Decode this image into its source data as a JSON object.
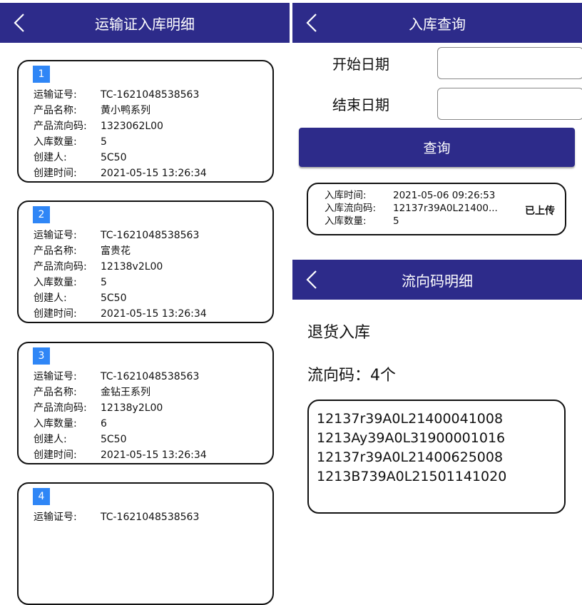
{
  "left_panel": {
    "title": "运输证入库明细",
    "cards": [
      {
        "index": "1",
        "rows": [
          [
            "运输证号:",
            "TC-1621048538563"
          ],
          [
            "产品名称:",
            "黄小鸭系列"
          ],
          [
            "产品流向码:",
            "1323062L00"
          ],
          [
            "入库数量:",
            "5"
          ],
          [
            "创建人:",
            "5C50"
          ],
          [
            "创建时间:",
            "2021-05-15 13:26:34"
          ]
        ]
      },
      {
        "index": "2",
        "rows": [
          [
            "运输证号:",
            "TC-1621048538563"
          ],
          [
            "产品名称:",
            "富贵花"
          ],
          [
            "产品流向码:",
            "12138v2L00"
          ],
          [
            "入库数量:",
            "5"
          ],
          [
            "创建人:",
            "5C50"
          ],
          [
            "创建时间:",
            "2021-05-15 13:26:34"
          ]
        ]
      },
      {
        "index": "3",
        "rows": [
          [
            "运输证号:",
            "TC-1621048538563"
          ],
          [
            "产品名称:",
            "金钻王系列"
          ],
          [
            "产品流向码:",
            "12138y2L00"
          ],
          [
            "入库数量:",
            "6"
          ],
          [
            "创建人:",
            "5C50"
          ],
          [
            "创建时间:",
            "2021-05-15 13:26:34"
          ]
        ]
      },
      {
        "index": "4",
        "rows": [
          [
            "运输证号:",
            "TC-1621048538563"
          ]
        ]
      }
    ]
  },
  "query_panel": {
    "title": "入库查询",
    "start_date_label": "开始日期",
    "end_date_label": "结束日期",
    "start_date_value": "",
    "end_date_value": "",
    "query_button": "查询",
    "result": {
      "rows": [
        [
          "入库时间:",
          "2021-05-06 09:26:53"
        ],
        [
          "入库流向码:",
          "12137r39A0L21400..."
        ],
        [
          "入库数量:",
          "5"
        ]
      ],
      "status": "已上传"
    }
  },
  "flow_panel": {
    "title": "流向码明细",
    "type_label": "退货入库",
    "count_label": "流向码：4个",
    "codes": [
      "12137r39A0L21400041008",
      "1213Ay39A0L31900001016",
      "12137r39A0L21400625008",
      "1213B739A0L21501141020"
    ]
  },
  "colors": {
    "header": "#2d2b8a",
    "badge": "#2f86f6"
  },
  "icons": {
    "back": "chevron-left-icon"
  }
}
